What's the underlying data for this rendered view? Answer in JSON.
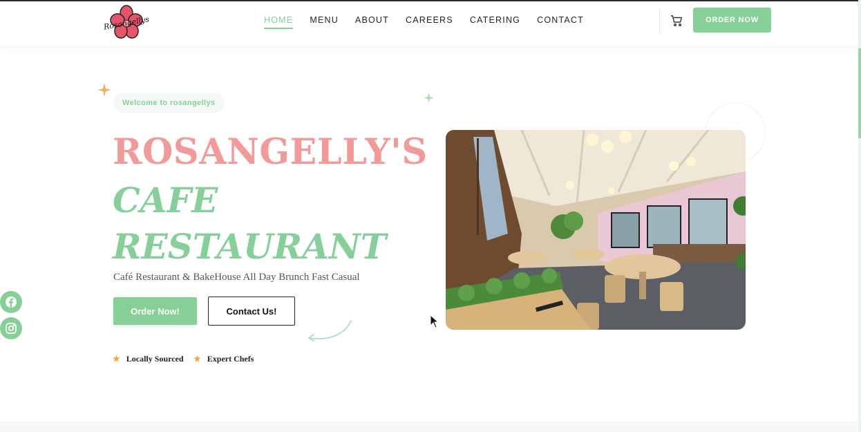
{
  "brand": {
    "logo_text": "Rosangellys"
  },
  "nav": {
    "items": [
      {
        "label": "HOME",
        "active": true
      },
      {
        "label": "MENU"
      },
      {
        "label": "ABOUT"
      },
      {
        "label": "CAREERS"
      },
      {
        "label": "CATERING"
      },
      {
        "label": "CONTACT"
      }
    ],
    "cart_icon": "cart-icon",
    "order_button": "ORDER NOW"
  },
  "hero": {
    "welcome": "Welcome to rosangellys",
    "title_line1": "ROSANGELLY'S",
    "title_line2": "CAFE",
    "title_line3": "RESTAURANT",
    "subtitle": "Café Restaurant & BakeHouse All Day Brunch Fast Casual",
    "order_button": "Order Now!",
    "contact_button": "Contact Us!",
    "features": [
      "Locally Sourced",
      "Expert Chefs"
    ],
    "image_icon": "restaurant-interior-photo"
  },
  "social": [
    {
      "icon": "facebook-icon"
    },
    {
      "icon": "instagram-icon"
    }
  ],
  "colors": {
    "accent_green": "#86cf98",
    "accent_pink": "#f19a98",
    "star": "#f0a43b"
  }
}
